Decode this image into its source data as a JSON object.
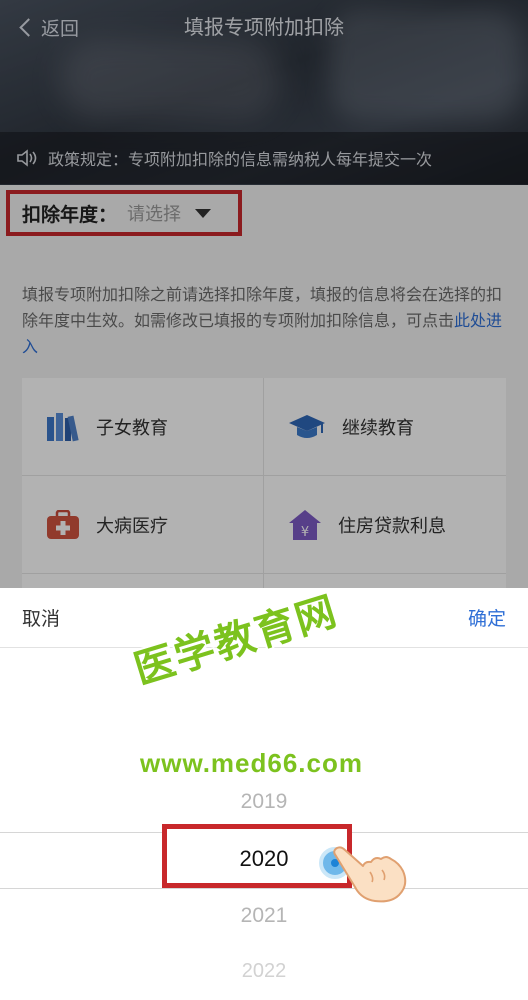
{
  "nav": {
    "back_label": "返回",
    "title": "填报专项附加扣除"
  },
  "notice": {
    "text": "政策规定：专项附加扣除的信息需纳税人每年提交一次"
  },
  "year_selector": {
    "label": "扣除年度：",
    "placeholder": "请选择"
  },
  "description": {
    "text": "填报专项附加扣除之前请选择扣除年度，填报的信息将会在选择的扣除年度中生效。如需修改已填报的专项附加扣除信息，可点击",
    "link": "此处进入"
  },
  "categories": [
    {
      "label": "子女教育",
      "icon": "books-icon"
    },
    {
      "label": "继续教育",
      "icon": "graduation-cap-icon"
    },
    {
      "label": "大病医疗",
      "icon": "medical-kit-icon"
    },
    {
      "label": "住房贷款利息",
      "icon": "house-yen-icon"
    }
  ],
  "picker": {
    "cancel_label": "取消",
    "confirm_label": "确定",
    "options": [
      "2019",
      "2020",
      "2021",
      "2022"
    ],
    "selected": "2020"
  },
  "watermark": {
    "brand": "医学教育网",
    "url": "www.med66.com"
  },
  "colors": {
    "accent_blue": "#2f6fd6",
    "highlight_red": "#c8282b",
    "watermark_green": "#7cc21e"
  }
}
